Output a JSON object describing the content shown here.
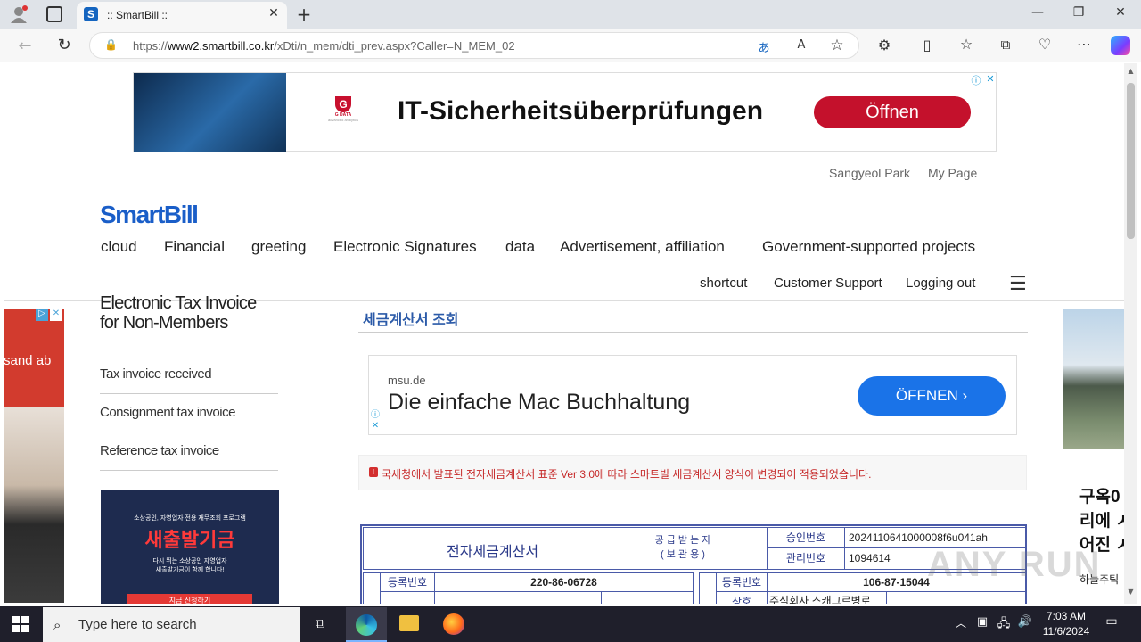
{
  "browser": {
    "tab_title": ":: SmartBill ::",
    "url_prefix": "https://",
    "url_domain": "www2.smartbill.co.kr",
    "url_path": "/xDti/n_mem/dti_prev.aspx?Caller=N_MEM_02"
  },
  "ad_top": {
    "brand": "G DATA",
    "brand_sub": "advanced analytics",
    "headline": "IT-Sicherheitsüberprüfungen",
    "button": "Öffnen"
  },
  "header": {
    "user_name": "Sangyeol Park",
    "my_page": "My Page",
    "logo": "SmartBill",
    "nav": [
      "cloud",
      "Financial",
      "greeting",
      "Electronic Signatures",
      "data",
      "Advertisement, affiliation",
      "Government-supported projects"
    ],
    "sub_nav": [
      "shortcut",
      "Customer Support",
      "Logging out"
    ]
  },
  "left_ad": {
    "text": "sand ab"
  },
  "sidebar": {
    "title_line1": "Electronic Tax Invoice",
    "title_line2": "for Non-Members",
    "items": [
      "Tax invoice received",
      "Consignment tax invoice",
      "Reference tax invoice"
    ],
    "banner_line1": "소상공인, 자영업자 전용 재무조회 프로그램",
    "banner_title": "새출발기금",
    "banner_line2": "다시 뛰는 소상공인 자영업자",
    "banner_line3": "새출발기금이 함께 합니다!",
    "banner_button": "지금 신청하기"
  },
  "main": {
    "section_title": "세금계산서 조회",
    "ad": {
      "domain": "msu.de",
      "headline": "Die einfache Mac Buchhaltung",
      "button": "ÖFFNEN"
    },
    "notice": "국세청에서 발표된 전자세금계산서 표준 Ver 3.0에 따라 스마트빌 세금계산서 양식이 변경되어 적용되었습니다.",
    "invoice": {
      "title": "전자세금계산서",
      "subtitle_line1": "공 급 받 는 자",
      "subtitle_line2": "( 보 관 용 )",
      "approval_label": "승인번호",
      "approval_value": "2024110641000008f6u041ah",
      "mgmt_label": "관리번호",
      "mgmt_value": "1094614",
      "reg_label": "등록번호",
      "supplier_reg": "220-86-06728",
      "buyer_reg": "106-87-15044",
      "name_label": "상호",
      "buyer_name_partial": "주식회사 스캐그르병로"
    }
  },
  "right_ad": {
    "text1": "구옥0",
    "text2": "리에 ㅅ",
    "text3": "어진 ㅅ",
    "text4": "하늘주틱"
  },
  "watermark": "ANY RUN",
  "taskbar": {
    "search_placeholder": "Type here to search",
    "time": "7:03 AM",
    "date": "11/6/2024"
  }
}
